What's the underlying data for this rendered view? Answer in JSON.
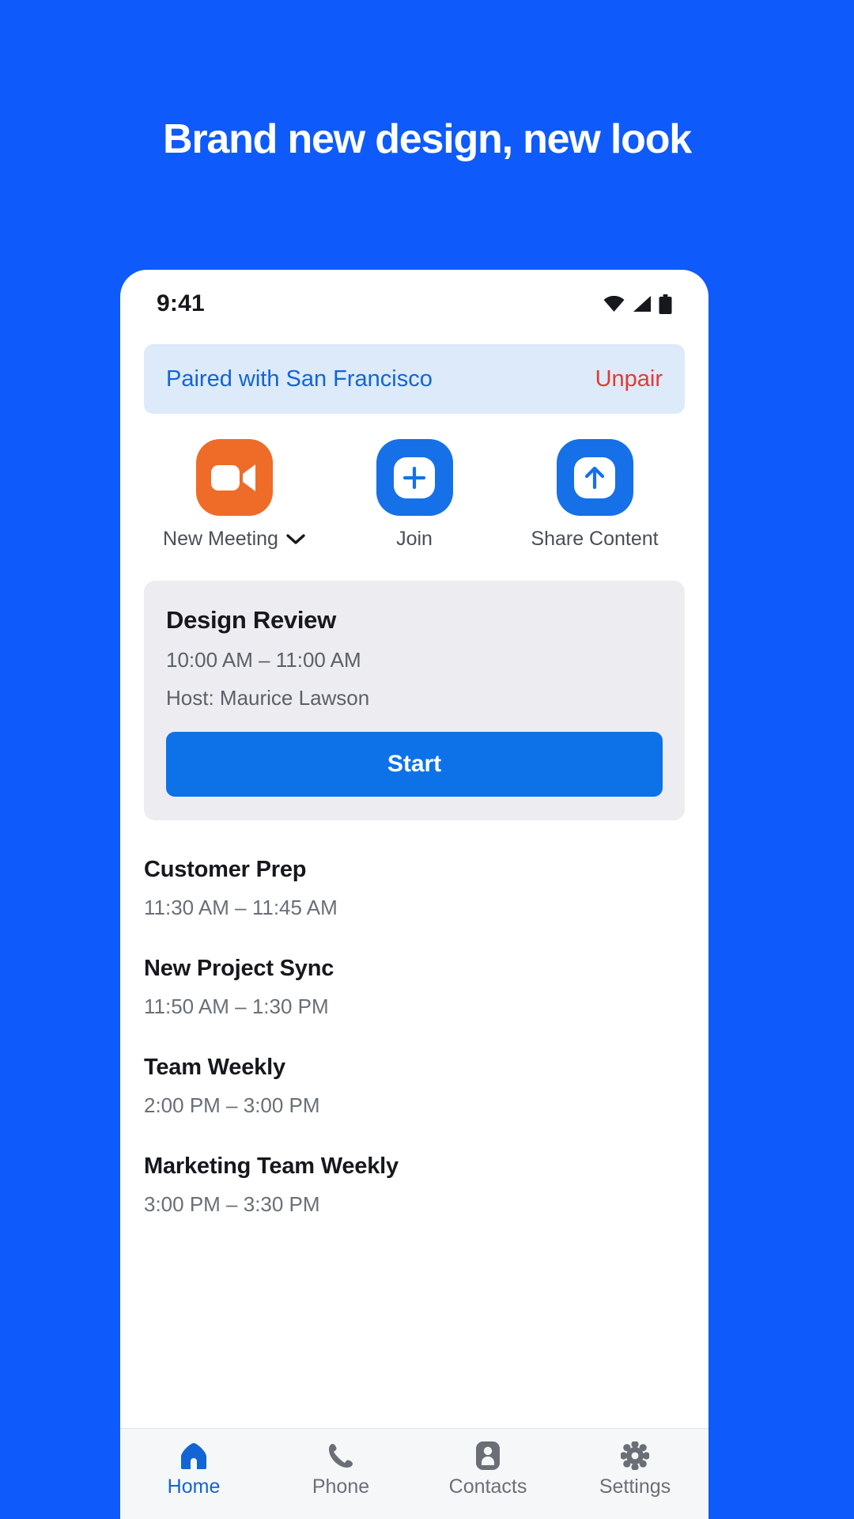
{
  "hero": {
    "title": "Brand new design, new look",
    "background_color": "#0E5AFB",
    "title_color": "#FFFFFF"
  },
  "phone": {
    "statusbar": {
      "time": "9:41",
      "icons": [
        "wifi-icon",
        "signal-icon",
        "battery-icon"
      ]
    },
    "paired_banner": {
      "text": "Paired with San Francisco",
      "action_label": "Unpair",
      "text_color": "#1464D4",
      "action_color": "#E23B32",
      "background_color": "#DCEAFA"
    },
    "actions": [
      {
        "label": "New Meeting",
        "icon": "video-camera-icon",
        "tile_color": "#EE6C28",
        "has_chevron": true
      },
      {
        "label": "Join",
        "icon": "plus-square-icon",
        "tile_color": "#1670E8",
        "has_chevron": false
      },
      {
        "label": "Share Content",
        "icon": "upload-arrow-icon",
        "tile_color": "#1670E8",
        "has_chevron": false
      }
    ],
    "featured_meeting": {
      "title": "Design Review",
      "time": "10:00 AM – 11:00 AM",
      "host": "Host: Maurice Lawson",
      "start_label": "Start",
      "card_color": "#EDEDF1",
      "button_color": "#0D72E8"
    },
    "meetings": [
      {
        "title": "Customer Prep",
        "time": "11:30 AM – 11:45 AM"
      },
      {
        "title": "New Project Sync",
        "time": "11:50 AM – 1:30 PM"
      },
      {
        "title": "Team Weekly",
        "time": "2:00 PM – 3:00 PM"
      },
      {
        "title": "Marketing Team Weekly",
        "time": "3:00 PM – 3:30 PM"
      }
    ],
    "tabs": [
      {
        "label": "Home",
        "icon": "home-icon",
        "active": true
      },
      {
        "label": "Phone",
        "icon": "phone-icon",
        "active": false
      },
      {
        "label": "Contacts",
        "icon": "contact-icon",
        "active": false
      },
      {
        "label": "Settings",
        "icon": "gear-icon",
        "active": false
      }
    ],
    "accent_color": "#1464D4",
    "inactive_color": "#6A6F77"
  }
}
